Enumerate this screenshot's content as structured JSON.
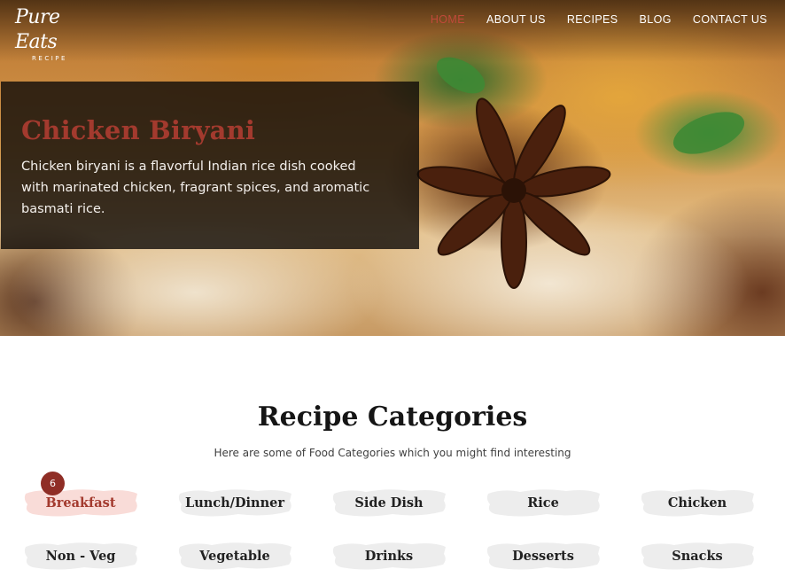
{
  "brand": {
    "name": "Pure Eats",
    "tagline": "RECIPE"
  },
  "nav": {
    "items": [
      {
        "label": "HOME",
        "active": true
      },
      {
        "label": "ABOUT US",
        "active": false
      },
      {
        "label": "RECIPES",
        "active": false
      },
      {
        "label": "BLOG",
        "active": false
      },
      {
        "label": "CONTACT US",
        "active": false
      }
    ]
  },
  "hero": {
    "title": "Chicken Biryani",
    "description": "Chicken biryani is a flavorful Indian rice dish cooked with marinated chicken, fragrant spices, and aromatic basmati rice."
  },
  "categories": {
    "title": "Recipe Categories",
    "subtitle": "Here are some of Food Categories which you might find interesting",
    "active_count": "6",
    "items": [
      {
        "label": "Breakfast",
        "active": true
      },
      {
        "label": "Lunch/Dinner",
        "active": false
      },
      {
        "label": "Side Dish",
        "active": false
      },
      {
        "label": "Rice",
        "active": false
      },
      {
        "label": "Chicken",
        "active": false
      },
      {
        "label": "Non - Veg",
        "active": false
      },
      {
        "label": "Vegetable",
        "active": false
      },
      {
        "label": "Drinks",
        "active": false
      },
      {
        "label": "Desserts",
        "active": false
      },
      {
        "label": "Snacks",
        "active": false
      }
    ]
  },
  "colors": {
    "accent": "#a33a2e",
    "nav_active": "#c0493a",
    "badge": "#8f2e26",
    "brush_default": "#ededed",
    "brush_active": "#f9dcd8"
  }
}
